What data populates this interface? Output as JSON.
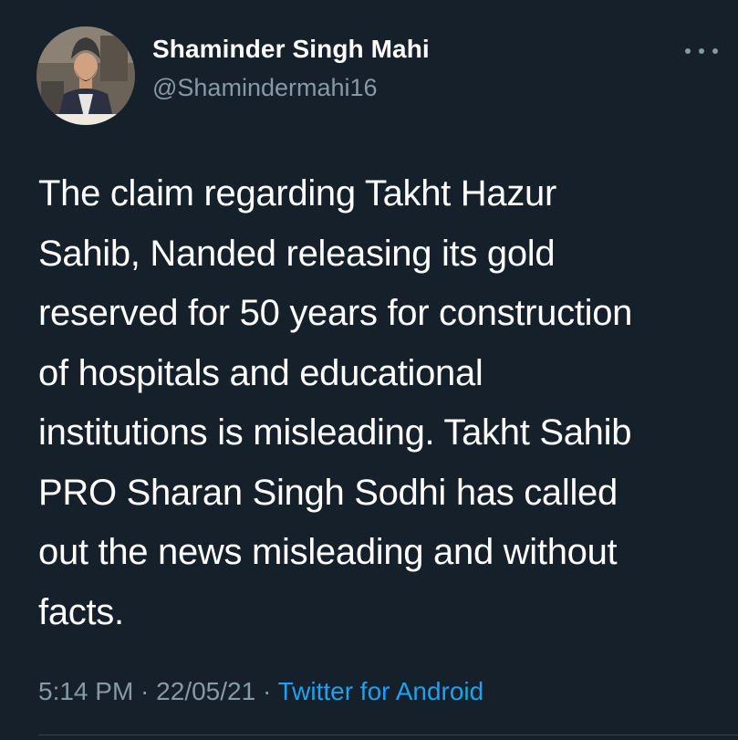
{
  "author": {
    "display_name": "Shaminder Singh Mahi",
    "handle": "@Shamindermahi16",
    "avatar": "profile-photo"
  },
  "more_icon": "more-horizontal-icon",
  "tweet": {
    "lines": [
      "The claim regarding Takht Hazur",
      "Sahib, Nanded releasing its gold",
      "reserved for 50 years for construction",
      "of hospitals and educational",
      "institutions is misleading. Takht Sahib",
      "PRO Sharan Singh Sodhi has called",
      "out the news misleading and without",
      "facts."
    ]
  },
  "meta": {
    "time": "5:14 PM",
    "separator": " · ",
    "date": "22/05/21",
    "source": "Twitter for Android"
  },
  "colors": {
    "background": "#15202b",
    "text_primary": "#ffffff",
    "text_secondary": "#8899a6",
    "link": "#1da1f2",
    "divider": "#38444d"
  }
}
